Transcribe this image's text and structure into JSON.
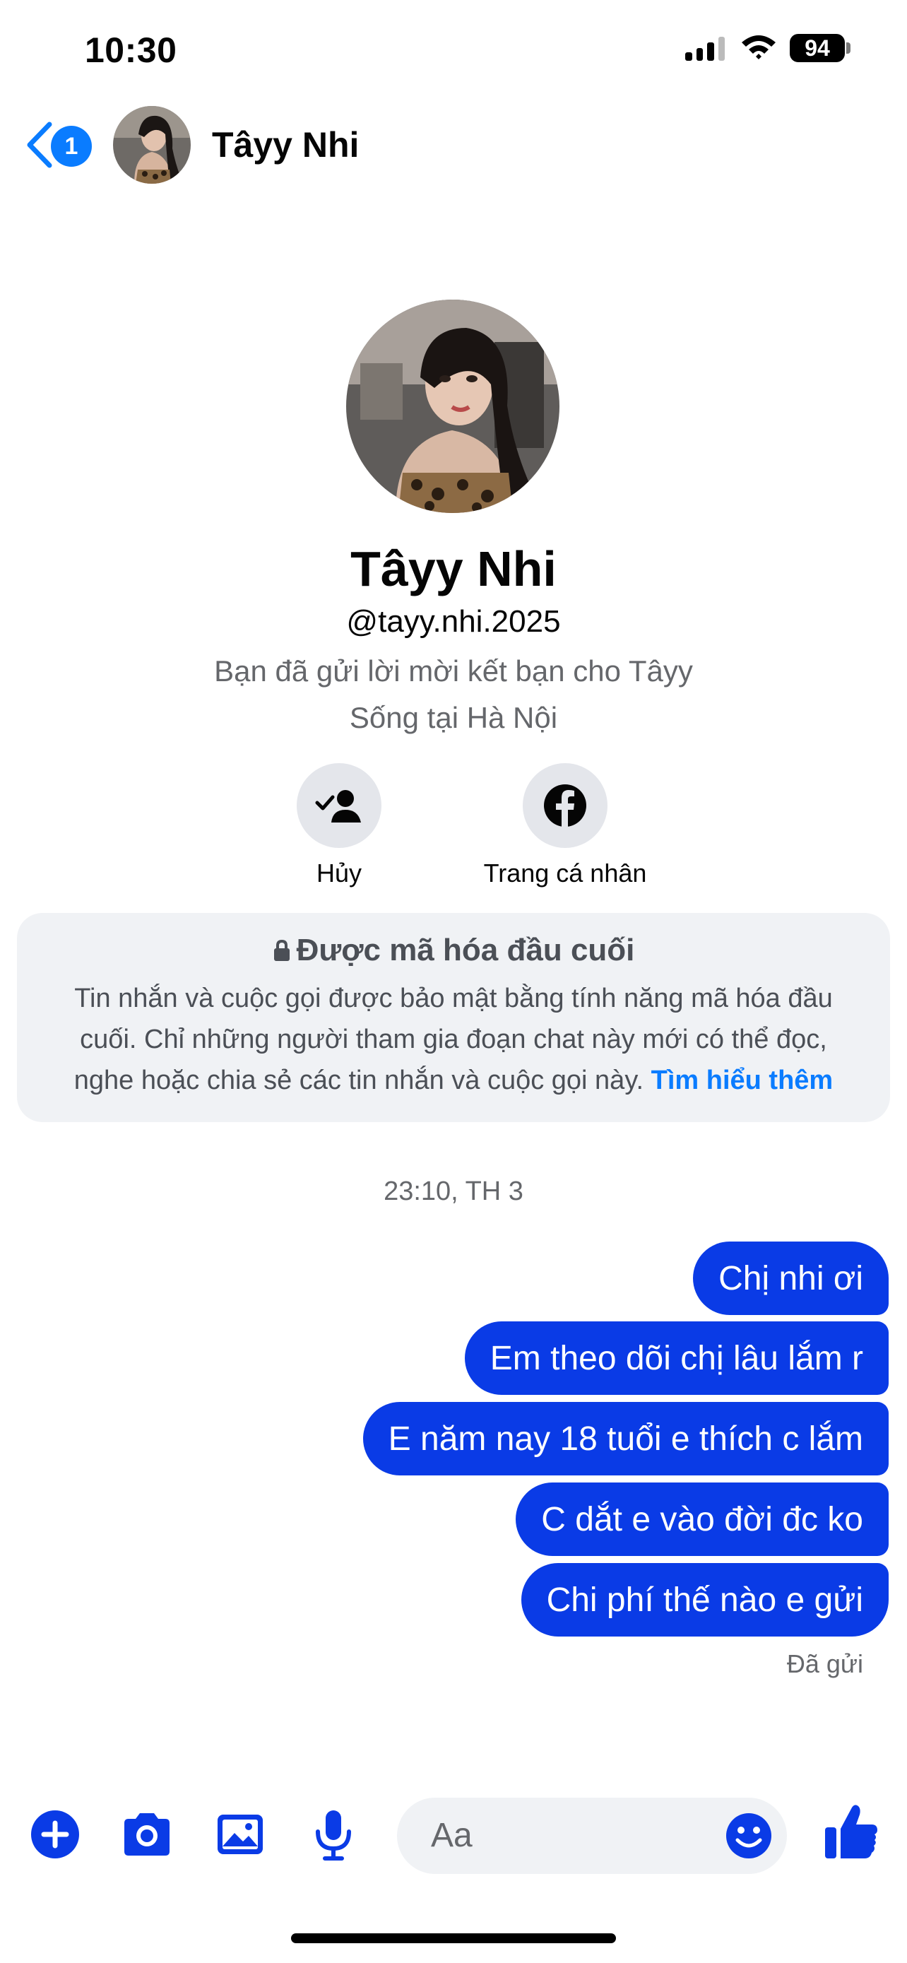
{
  "status_bar": {
    "time": "10:30",
    "battery": "94"
  },
  "header": {
    "back_badge": "1",
    "contact_name": "Tâyy Nhi"
  },
  "profile": {
    "name": "Tâyy Nhi",
    "handle": "@tayy.nhi.2025",
    "friend_request_status": "Bạn đã gửi lời mời kết bạn cho Tâyy",
    "location": "Sống tại Hà Nội",
    "actions": {
      "cancel_label": "Hủy",
      "profile_label": "Trang cá nhân"
    }
  },
  "encryption_notice": {
    "title": "Được mã hóa đầu cuối",
    "body_lines": [
      "Tin nhắn và cuộc gọi được bảo mật bằng tính năng mã hóa đầu",
      "cuối. Chỉ những người tham gia đoạn chat này mới có thể đọc,",
      "nghe hoặc chia sẻ các tin nhắn và cuộc gọi này."
    ],
    "learn_more": "Tìm hiểu thêm"
  },
  "conversation": {
    "timestamp": "23:10, TH 3",
    "messages": [
      {
        "text": "Chị nhi ơi"
      },
      {
        "text": "Em theo dõi chị lâu lắm r"
      },
      {
        "text": "E năm nay 18 tuổi e thích c lắm"
      },
      {
        "text": "C dắt e vào đời đc ko"
      },
      {
        "text": "Chi phí thế nào e gửi"
      }
    ],
    "delivery_status": "Đã gửi"
  },
  "composer": {
    "placeholder": "Aa"
  },
  "colors": {
    "accent": "#0a7cff",
    "bubble": "#0a3be6",
    "icon": "#0a3be6"
  }
}
